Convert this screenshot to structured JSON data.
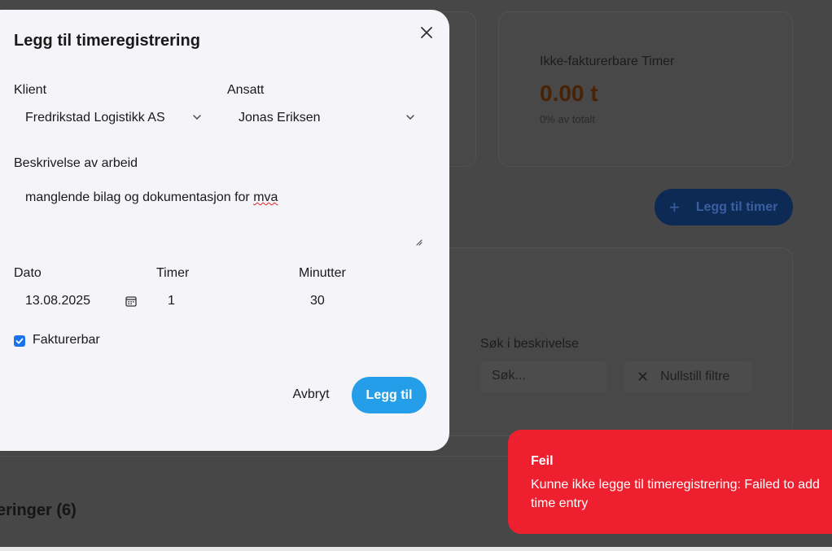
{
  "background": {
    "card_title": "Ikke-fakturerbare Timer",
    "card_value": "0.00 t",
    "card_sub": "0% av totalt",
    "add_button_label": "Legg til timer",
    "search_label": "Søk i beskrivelse",
    "search_placeholder": "Søk...",
    "reset_label": "Nullstill filtre",
    "section_title": "eringer (6)"
  },
  "modal": {
    "title": "Legg til timeregistrering",
    "client_label": "Klient",
    "client_value": "Fredrikstad Logistikk AS",
    "employee_label": "Ansatt",
    "employee_value": "Jonas Eriksen",
    "description_label": "Beskrivelse av arbeid",
    "description_prefix": "manglende bilag og dokumentasjon for ",
    "description_misspelled": "mva",
    "date_label": "Dato",
    "date_value": "13.08.2025",
    "hours_label": "Timer",
    "hours_value": "1",
    "minutes_label": "Minutter",
    "minutes_value": "30",
    "billable_label": "Fakturerbar",
    "billable_checked": true,
    "cancel_label": "Avbryt",
    "submit_label": "Legg til"
  },
  "toast": {
    "title": "Feil",
    "message": "Kunne ikke legge til timeregistrering: Failed to add time entry",
    "color": "#ee2030"
  },
  "colors": {
    "accent": "#249ee8",
    "checkbox": "#1a73e8"
  },
  "icons": {
    "close": "close-icon",
    "chevron": "chevron-down-icon",
    "calendar": "calendar-icon",
    "plus": "plus-icon",
    "reset": "x-icon"
  }
}
